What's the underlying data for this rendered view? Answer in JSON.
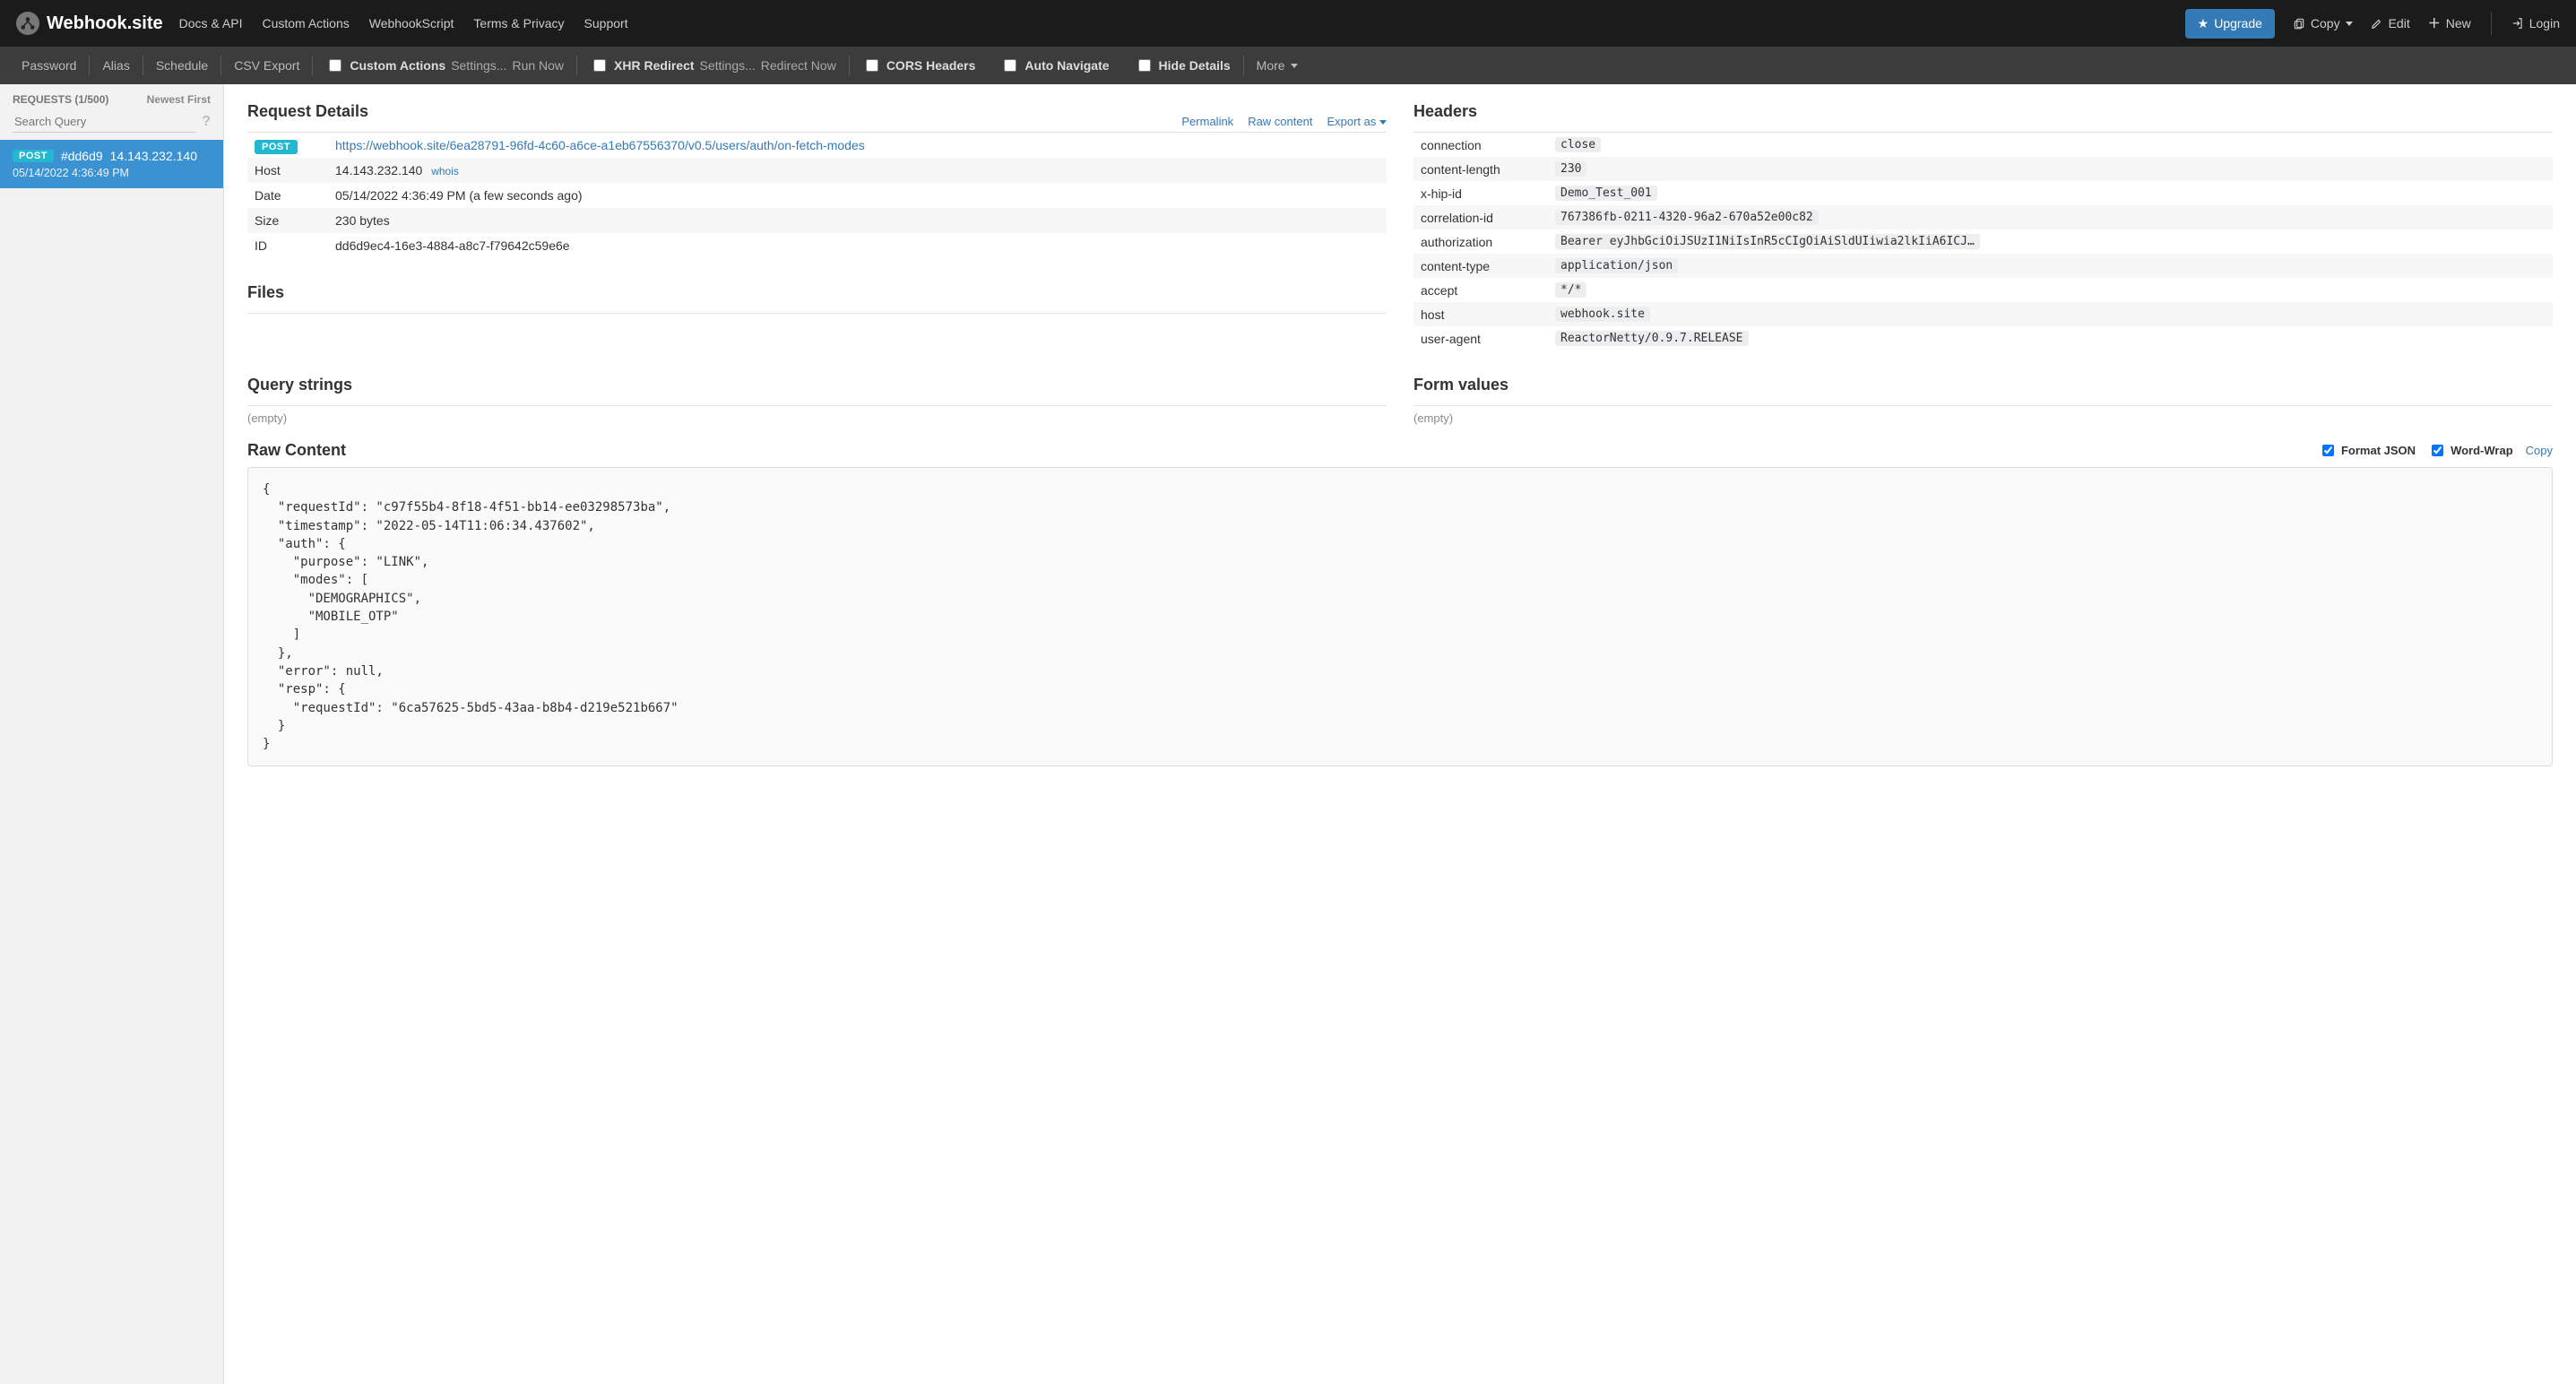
{
  "brand": "Webhook.site",
  "nav": {
    "left": [
      "Docs & API",
      "Custom Actions",
      "WebhookScript",
      "Terms & Privacy",
      "Support"
    ],
    "upgrade": "Upgrade",
    "copy": "Copy",
    "edit": "Edit",
    "new": "New",
    "login": "Login"
  },
  "toolbar": {
    "password": "Password",
    "alias": "Alias",
    "schedule": "Schedule",
    "csv": "CSV Export",
    "custom_actions": "Custom Actions",
    "ca_settings": "Settings...",
    "ca_run": "Run Now",
    "xhr": "XHR Redirect",
    "xhr_settings": "Settings...",
    "xhr_redirect_now": "Redirect Now",
    "cors": "CORS Headers",
    "auto_nav": "Auto Navigate",
    "hide_details": "Hide Details",
    "more": "More"
  },
  "sidebar": {
    "heading": "REQUESTS (1/500)",
    "sort": "Newest First",
    "search_placeholder": "Search Query",
    "item": {
      "method": "POST",
      "hash": "#dd6d9",
      "ip": "14.143.232.140",
      "ts": "05/14/2022 4:36:49 PM"
    }
  },
  "details": {
    "title": "Request Details",
    "actions": {
      "permalink": "Permalink",
      "raw": "Raw content",
      "export": "Export as"
    },
    "method": "POST",
    "url": "https://webhook.site/6ea28791-96fd-4c60-a6ce-a1eb67556370/v0.5/users/auth/on-fetch-modes",
    "rows": {
      "host_label": "Host",
      "host_value": "14.143.232.140",
      "whois": "whois",
      "date_label": "Date",
      "date_value": "05/14/2022 4:36:49 PM (a few seconds ago)",
      "size_label": "Size",
      "size_value": "230 bytes",
      "id_label": "ID",
      "id_value": "dd6d9ec4-16e3-4884-a8c7-f79642c59e6e"
    },
    "files_title": "Files"
  },
  "headers_title": "Headers",
  "headers": [
    {
      "k": "connection",
      "v": "close"
    },
    {
      "k": "content-length",
      "v": "230"
    },
    {
      "k": "x-hip-id",
      "v": "Demo_Test_001"
    },
    {
      "k": "correlation-id",
      "v": "767386fb-0211-4320-96a2-670a52e00c82"
    },
    {
      "k": "authorization",
      "v": "Bearer eyJhbGciOiJSUzI1NiIsInR5cCIgOiAiSldUIiwia2lkIiA6ICJ…"
    },
    {
      "k": "content-type",
      "v": "application/json"
    },
    {
      "k": "accept",
      "v": "*/*"
    },
    {
      "k": "host",
      "v": "webhook.site"
    },
    {
      "k": "user-agent",
      "v": "ReactorNetty/0.9.7.RELEASE"
    }
  ],
  "query": {
    "title": "Query strings",
    "empty": "(empty)"
  },
  "form": {
    "title": "Form values",
    "empty": "(empty)"
  },
  "raw": {
    "title": "Raw Content",
    "format_json": "Format JSON",
    "wrap": "Word-Wrap",
    "copy": "Copy",
    "body": "{\n  \"requestId\": \"c97f55b4-8f18-4f51-bb14-ee03298573ba\",\n  \"timestamp\": \"2022-05-14T11:06:34.437602\",\n  \"auth\": {\n    \"purpose\": \"LINK\",\n    \"modes\": [\n      \"DEMOGRAPHICS\",\n      \"MOBILE_OTP\"\n    ]\n  },\n  \"error\": null,\n  \"resp\": {\n    \"requestId\": \"6ca57625-5bd5-43aa-b8b4-d219e521b667\"\n  }\n}"
  }
}
